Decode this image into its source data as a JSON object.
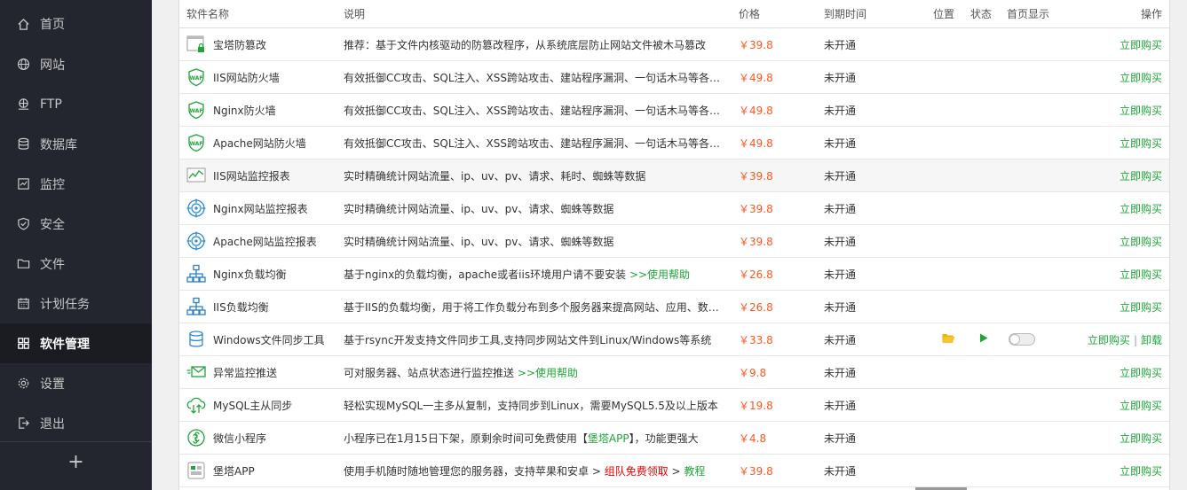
{
  "sidebar": {
    "items": [
      {
        "label": "首页",
        "icon": "home-icon"
      },
      {
        "label": "网站",
        "icon": "globe-icon"
      },
      {
        "label": "FTP",
        "icon": "ftp-icon"
      },
      {
        "label": "数据库",
        "icon": "database-icon"
      },
      {
        "label": "监控",
        "icon": "monitor-icon"
      },
      {
        "label": "安全",
        "icon": "shield-icon"
      },
      {
        "label": "文件",
        "icon": "folder-icon"
      },
      {
        "label": "计划任务",
        "icon": "calendar-icon"
      },
      {
        "label": "软件管理",
        "icon": "apps-icon",
        "active": true
      },
      {
        "label": "设置",
        "icon": "gear-icon"
      },
      {
        "label": "退出",
        "icon": "logout-icon"
      }
    ],
    "add_label": "+"
  },
  "table": {
    "headers": {
      "name": "软件名称",
      "desc": "说明",
      "price": "价格",
      "expire": "到期时间",
      "location": "位置",
      "status": "状态",
      "home": "首页显示",
      "ops": "操作"
    },
    "buy_label": "立即购买",
    "uninstall_label": "卸载",
    "sep": "|",
    "rows": [
      {
        "name": "宝塔防篡改",
        "icon": "tamper-proof-icon",
        "desc": "推荐：基于文件内核驱动的防篡改程序，从系统底层防止网站文件被木马篡改",
        "price": "￥39.8",
        "expire": "未开通"
      },
      {
        "name": "IIS网站防火墙",
        "icon": "waf-shield-icon",
        "desc": "有效抵御CC攻击、SQL注入、XSS跨站攻击、建站程序漏洞、一句话木马等各种攻击",
        "price": "￥49.8",
        "expire": "未开通"
      },
      {
        "name": "Nginx防火墙",
        "icon": "waf-shield-icon",
        "desc": "有效抵御CC攻击、SQL注入、XSS跨站攻击、建站程序漏洞、一句话木马等各种攻击",
        "price": "￥49.8",
        "expire": "未开通"
      },
      {
        "name": "Apache网站防火墙",
        "icon": "waf-shield-icon",
        "desc": "有效抵御CC攻击、SQL注入、XSS跨站攻击、建站程序漏洞、一句话木马等各种攻击",
        "price": "￥49.8",
        "expire": "未开通"
      },
      {
        "name": "IIS网站监控报表",
        "icon": "chart-report-icon",
        "desc": "实时精确统计网站流量、ip、uv、pv、请求、耗时、蜘蛛等数据",
        "price": "￥39.8",
        "expire": "未开通",
        "highlight": true
      },
      {
        "name": "Nginx网站监控报表",
        "icon": "target-icon",
        "desc": "实时精确统计网站流量、ip、uv、pv、请求、蜘蛛等数据",
        "price": "￥39.8",
        "expire": "未开通"
      },
      {
        "name": "Apache网站监控报表",
        "icon": "target-icon",
        "desc": "实时精确统计网站流量、ip、uv、pv、请求、蜘蛛等数据",
        "price": "￥39.8",
        "expire": "未开通"
      },
      {
        "name": "Nginx负载均衡",
        "icon": "network-tree-icon",
        "desc": "基于nginx的负载均衡，apache或者iis环境用户请不要安装",
        "help": ">>使用帮助",
        "price": "￥26.8",
        "expire": "未开通"
      },
      {
        "name": "IIS负载均衡",
        "icon": "network-tree-icon",
        "desc": "基于IIS的负载均衡，用于将工作负载分布到多个服务器来提高网站、应用、数据库或其他服务的性能和可靠性",
        "price": "￥26.8",
        "expire": "未开通"
      },
      {
        "name": "Windows文件同步工具",
        "icon": "sync-database-icon",
        "desc": "基于rsync开发支持文件同步工具,支持同步网站文件到Linux/Windows等系统",
        "price": "￥33.8",
        "expire": "未开通",
        "installed": true
      },
      {
        "name": "异常监控推送",
        "icon": "push-mail-icon",
        "desc": "可对服务器、站点状态进行监控推送",
        "help": ">>使用帮助",
        "price": "￥9.8",
        "expire": "未开通"
      },
      {
        "name": "MySQL主从同步",
        "icon": "cloud-sync-icon",
        "desc": "轻松实现MySQL一主多从复制，支持同步到Linux，需要MySQL5.5及以上版本",
        "price": "￥19.8",
        "expire": "未开通"
      },
      {
        "name": "微信小程序",
        "icon": "wechat-mini-icon",
        "desc": "小程序已在1月15日下架，原剩余时间可免费使用【",
        "desc_link": "堡塔APP",
        "desc_tail": "】，功能更强大",
        "price": "￥4.8",
        "expire": "未开通"
      },
      {
        "name": "堡塔APP",
        "icon": "app-icon",
        "desc": "使用手机随时随地管理您的服务器，支持苹果和安卓 > ",
        "red": "组队免费领取",
        "tail_sep": " > ",
        "tail_link": "教程",
        "price": "￥39.8",
        "expire": "未开通"
      }
    ]
  }
}
